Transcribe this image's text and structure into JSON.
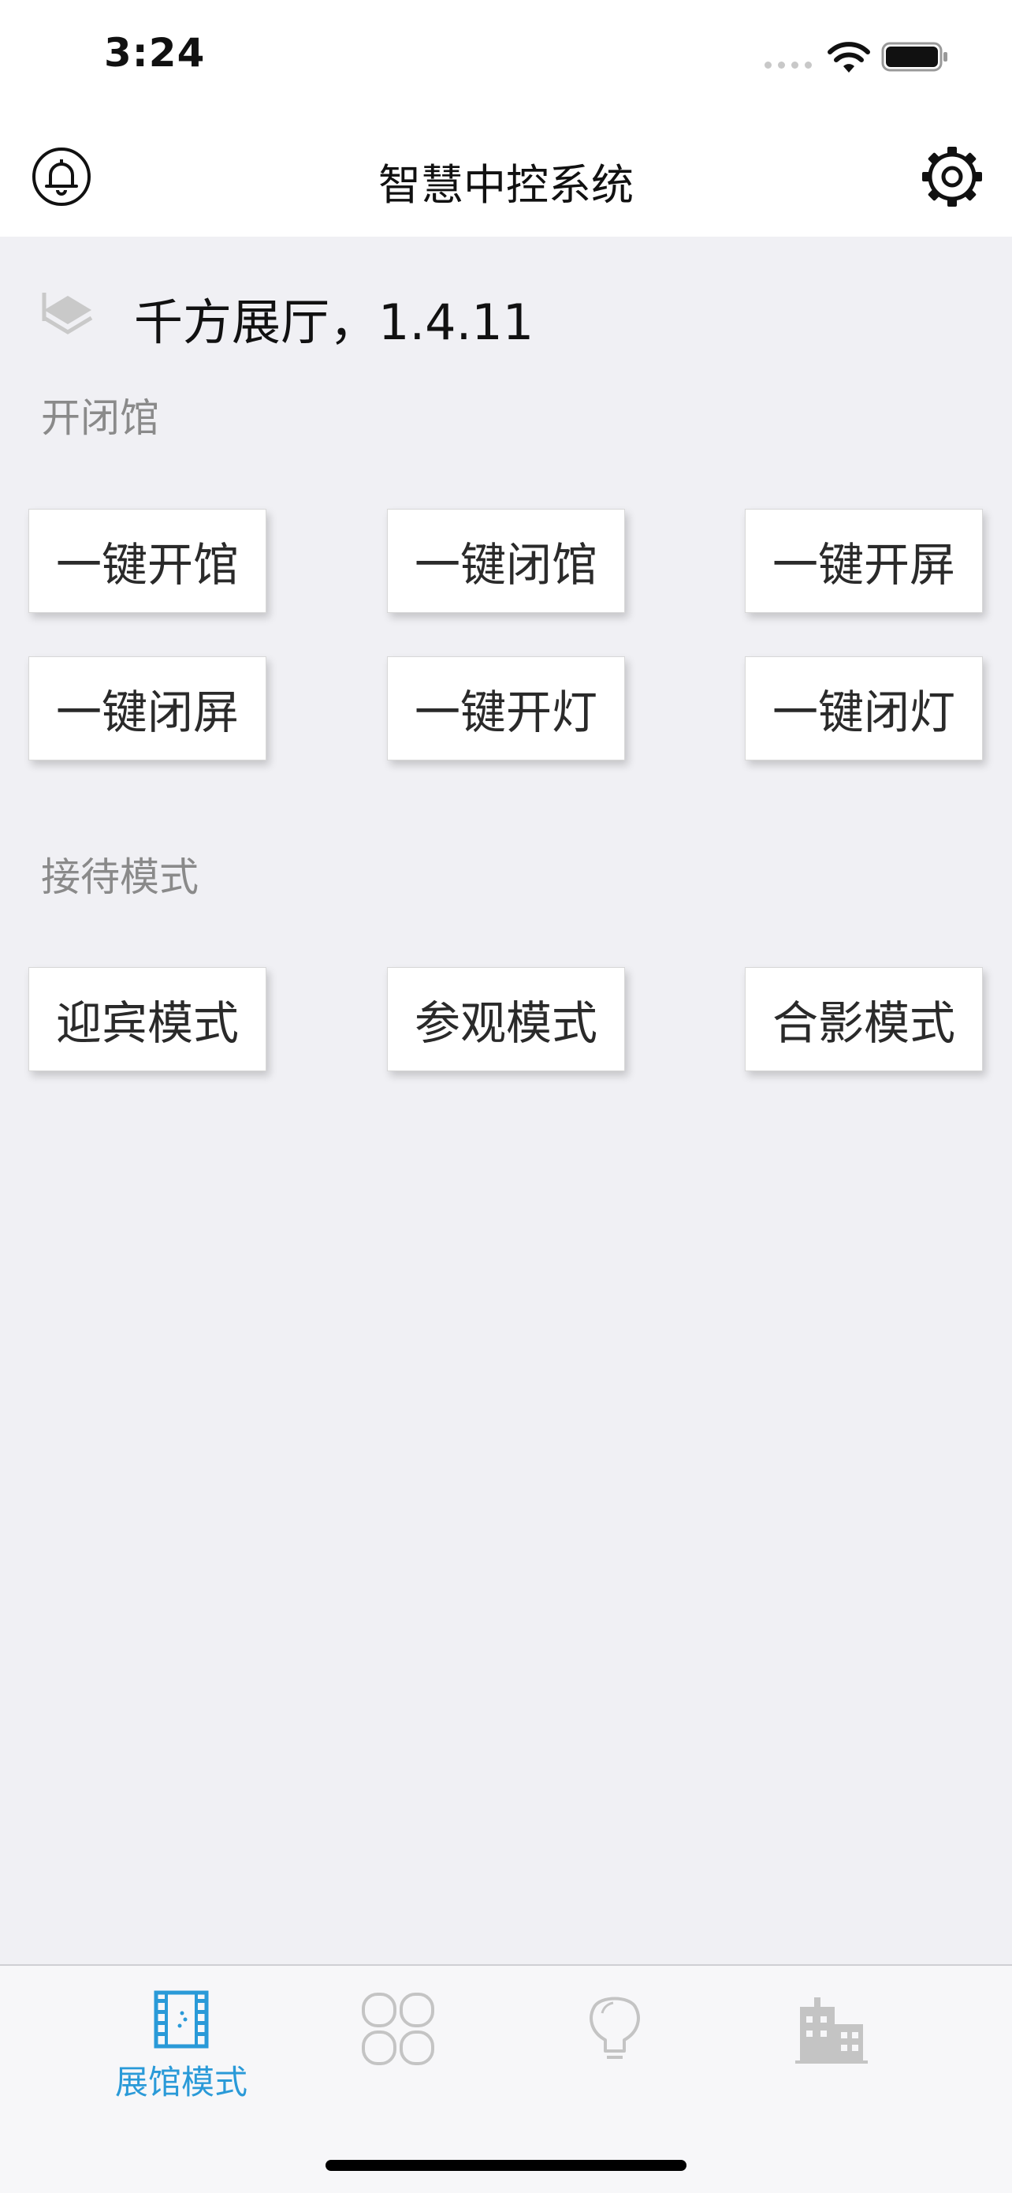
{
  "status_bar": {
    "time": "3:24"
  },
  "header": {
    "title": "智慧中控系统",
    "left_icon": "bell-icon",
    "right_icon": "gear-icon"
  },
  "venue": {
    "name": "千方展厅，1.4.11",
    "icon": "layers-icon"
  },
  "sections": [
    {
      "title": "开闭馆",
      "buttons": [
        "一键开馆",
        "一键闭馆",
        "一键开屏",
        "一键闭屏",
        "一键开灯",
        "一键闭灯"
      ]
    },
    {
      "title": "接待模式",
      "buttons": [
        "迎宾模式",
        "参观模式",
        "合影模式"
      ]
    }
  ],
  "tab_bar": {
    "active_color": "#2a9ad8",
    "inactive_color": "#c4c4c4",
    "tabs": [
      {
        "label": "展馆模式",
        "icon": "film-icon",
        "active": true
      },
      {
        "icon": "grid-circles-icon",
        "active": false
      },
      {
        "icon": "lightbulb-icon",
        "active": false
      },
      {
        "icon": "building-icon",
        "active": false
      }
    ]
  }
}
